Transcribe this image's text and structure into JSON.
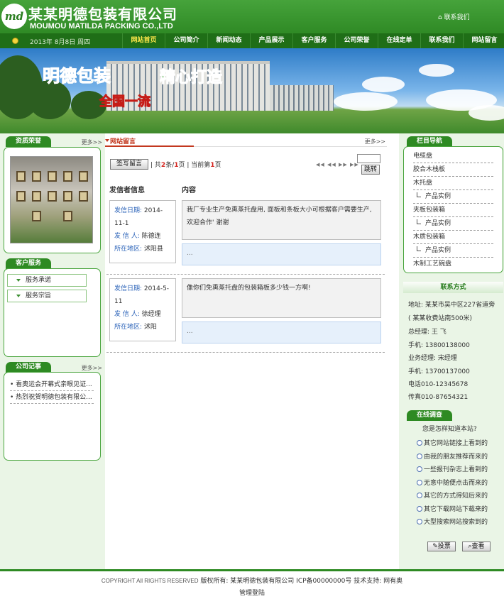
{
  "brand": {
    "logo_text": "md",
    "name_cn": "某某明德包装有限公司",
    "name_en": "MOUMOU MATILDA PACKING CO.,LTD",
    "contact_link": "联系我们"
  },
  "topbar": {
    "date": "2013年 8月8日 周四"
  },
  "nav": {
    "items": [
      "网站首页",
      "公司简介",
      "新闻动态",
      "产品展示",
      "客户服务",
      "公司荣誉",
      "在线定单",
      "联系我们",
      "网站留言"
    ]
  },
  "banner": {
    "slogan_1": "明德包装",
    "slogan_2": "精心打造",
    "slogan_3": "全国一流"
  },
  "left": {
    "honor": {
      "title": "资质荣誉",
      "more": "更多>>"
    },
    "service": {
      "title": "客户服务",
      "items": [
        "服务承诺",
        "服务宗旨"
      ]
    },
    "news": {
      "title": "公司记事",
      "more": "更多>>",
      "items": [
        "看奥运会开幕式亲眼见证...",
        "热烈祝贺明德包装有限公..."
      ]
    }
  },
  "center": {
    "title": "网站留言",
    "more": "更多>>",
    "write_button": "签写留言",
    "pager": {
      "prefix": "共",
      "total": "2",
      "mid": "条/",
      "pages": "1",
      "suffix": "页 | 当前第",
      "current": "1",
      "end": "页"
    },
    "pager_arrows": "◀◀ ◀◀ ▶▶ ▶▶",
    "goto_button": "跳转",
    "col_sender": "发信者信息",
    "col_content": "内容",
    "labels": {
      "date": "发信日期:",
      "sender": "发 信 人:",
      "region": "所在地区:"
    },
    "messages": [
      {
        "date_1": "2014-",
        "date_2": "11-1",
        "sender": "陈德连",
        "region": "沭阳县",
        "content": "我厂专业生产免熏蒸托盘用, 面板和条板大小可根据客户需要生产, 欢迎合作' 谢谢",
        "reply": "..."
      },
      {
        "date_1": "2014-5-",
        "date_2": "11",
        "sender": "徐经理",
        "region": "沭阳",
        "content": "像你们免熏蒸托盘的包装箱板多少钱一方啊!",
        "reply": "..."
      }
    ]
  },
  "right": {
    "categories": {
      "title": "栏目导航",
      "items": [
        {
          "label": "电缆盘",
          "sub": false
        },
        {
          "label": "胶合木栈板",
          "sub": false
        },
        {
          "label": "木托盘",
          "sub": false
        },
        {
          "label": "产品实例",
          "sub": true
        },
        {
          "label": "夹板包装箱",
          "sub": false
        },
        {
          "label": "产品实例",
          "sub": true
        },
        {
          "label": "木质包装箱",
          "sub": false
        },
        {
          "label": "产品实例",
          "sub": true
        },
        {
          "label": "木制工艺碗盘",
          "sub": false
        }
      ]
    },
    "contact": {
      "title": "联系方式",
      "lines": [
        "地址: 某某市吴中区227省道旁",
        "( 某某收费站南500米)",
        "总经理: 王 飞",
        "手机: 13800138000",
        "业务经理: 宋经理",
        "手机: 13700137000",
        "电话010-12345678",
        "传真010-87654321"
      ]
    },
    "survey": {
      "title": "在线调查",
      "question": "您是怎样知道本站?",
      "options": [
        "其它网站链接上看到的",
        "由我的朋友推荐而来的",
        "一些报刊杂志上看到的",
        "无意中随便点击而来的",
        "其它的方式得知后来的",
        "其它下载网站下载来的",
        "大型搜索网站搜索到的"
      ],
      "vote_button": "投票",
      "view_button": "查看"
    }
  },
  "footer": {
    "copyright_en": "COPYRIGHT All RIGHTS RESERVED",
    "copyright_cn": "版权所有: 某某明德包装有限公司 ICP备00000000号 技术支持: 网有奥",
    "admin": "管理登陆"
  },
  "colors": {
    "brand_green": "#2e8a23",
    "nav_dark": "#1f6e17",
    "active_nav": "#ffe84a",
    "accent_red": "#c3381f",
    "label_blue": "#2a62b8"
  }
}
